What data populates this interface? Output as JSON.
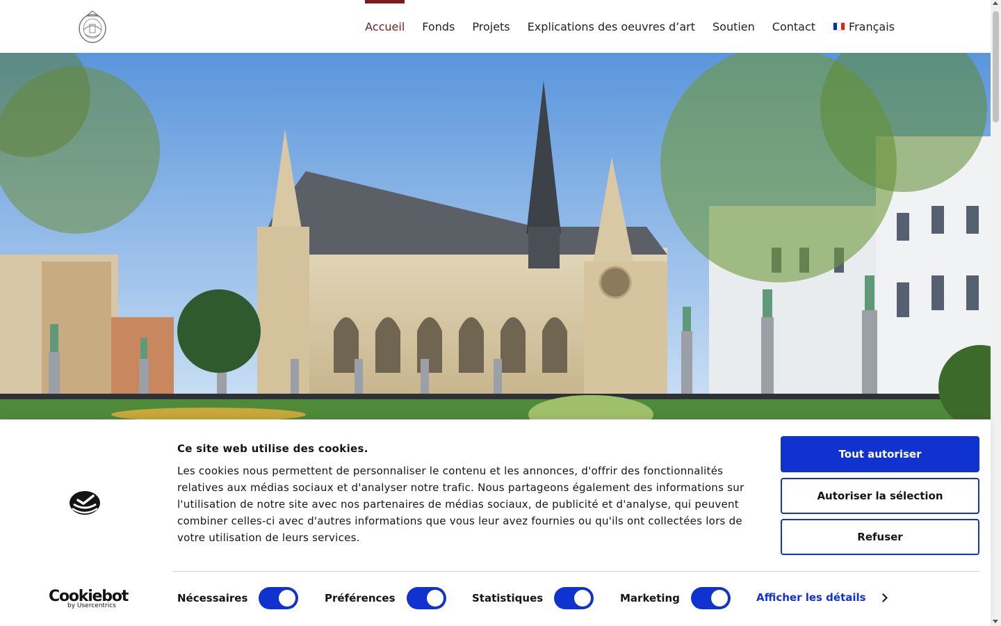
{
  "nav": {
    "items": [
      {
        "label": "Accueil",
        "active": true
      },
      {
        "label": "Fonds",
        "active": false
      },
      {
        "label": "Projets",
        "active": false
      },
      {
        "label": "Explications des oeuvres d’art",
        "active": false
      },
      {
        "label": "Soutien",
        "active": false
      },
      {
        "label": "Contact",
        "active": false
      }
    ],
    "language": "Français",
    "accent_color": "#7c1a1d"
  },
  "cookie": {
    "title": "Ce site web utilise des cookies.",
    "text": "Les cookies nous permettent de personnaliser le contenu et les annonces, d'offrir des fonctionnalités relatives aux médias sociaux et d'analyser notre trafic. Nous partageons également des informations sur l'utilisation de notre site avec nos partenaires de médias sociaux, de publicité et d'analyse, qui peuvent combiner celles-ci avec d'autres informations que vous leur avez fournies ou qu'ils ont collectées lors de votre utilisation de leurs services.",
    "buttons": {
      "allow_all": "Tout autoriser",
      "allow_selection": "Autoriser la sélection",
      "refuse": "Refuser"
    },
    "toggles": [
      {
        "label": "Nécessaires",
        "on": true
      },
      {
        "label": "Préférences",
        "on": true
      },
      {
        "label": "Statistiques",
        "on": true
      },
      {
        "label": "Marketing",
        "on": true
      }
    ],
    "details_link": "Afficher les détails",
    "brand": "Cookiebot",
    "brand_sub": "by Usercentrics",
    "brand_color": "#1032cf"
  },
  "icons": [
    "logo-emblem",
    "flag-fr-icon",
    "cookiebot-icon",
    "chevron-right-icon"
  ]
}
